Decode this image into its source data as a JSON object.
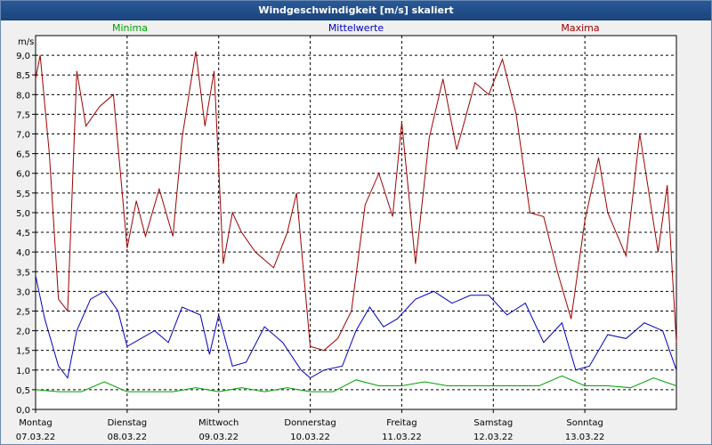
{
  "chart_data": {
    "type": "line",
    "title": "Windgeschwindigkeit [m/s] skaliert",
    "ylabel": "m/s",
    "ylim": [
      0,
      9.5
    ],
    "y_ticks": [
      "0,0",
      "0,5",
      "1,0",
      "1,5",
      "2,0",
      "2,5",
      "3,0",
      "3,5",
      "4,0",
      "4,5",
      "5,0",
      "5,5",
      "6,0",
      "6,5",
      "7,0",
      "7,5",
      "8,0",
      "8,5",
      "9,0"
    ],
    "x_range": [
      0,
      7
    ],
    "x_ticks": [
      {
        "day": "Montag",
        "date": "07.03.22"
      },
      {
        "day": "Dienstag",
        "date": "08.03.22"
      },
      {
        "day": "Mittwoch",
        "date": "09.03.22"
      },
      {
        "day": "Donnerstag",
        "date": "10.03.22"
      },
      {
        "day": "Freitag",
        "date": "11.03.22"
      },
      {
        "day": "Samstag",
        "date": "12.03.22"
      },
      {
        "day": "Sonntag",
        "date": "13.03.22"
      }
    ],
    "grid": true,
    "colors": {
      "min": "#00a000",
      "mean": "#0000c0",
      "max": "#a00000"
    },
    "series": [
      {
        "name": "Minima",
        "x": [
          0,
          0.25,
          0.5,
          0.75,
          1,
          1.25,
          1.5,
          1.75,
          2,
          2.25,
          2.5,
          2.75,
          3,
          3.25,
          3.5,
          3.75,
          4,
          4.25,
          4.5,
          4.75,
          5,
          5.25,
          5.5,
          5.75,
          6,
          6.25,
          6.5,
          6.75,
          7
        ],
        "values": [
          0.5,
          0.45,
          0.45,
          0.7,
          0.45,
          0.45,
          0.45,
          0.55,
          0.45,
          0.55,
          0.45,
          0.55,
          0.45,
          0.45,
          0.75,
          0.6,
          0.6,
          0.7,
          0.6,
          0.6,
          0.6,
          0.6,
          0.6,
          0.85,
          0.6,
          0.6,
          0.55,
          0.8,
          0.6
        ]
      },
      {
        "name": "Mittelwerte",
        "x": [
          0,
          0.1,
          0.25,
          0.35,
          0.45,
          0.6,
          0.75,
          0.9,
          1,
          1.15,
          1.3,
          1.45,
          1.6,
          1.8,
          1.9,
          2,
          2.15,
          2.3,
          2.5,
          2.7,
          2.9,
          3,
          3.15,
          3.35,
          3.5,
          3.65,
          3.8,
          3.95,
          4.15,
          4.35,
          4.55,
          4.75,
          4.95,
          5.15,
          5.35,
          5.55,
          5.75,
          5.9,
          6.05,
          6.25,
          6.45,
          6.65,
          6.85,
          7
        ],
        "values": [
          3.4,
          2.3,
          1.1,
          0.8,
          2.0,
          2.8,
          3.0,
          2.5,
          1.6,
          1.8,
          2.0,
          1.7,
          2.6,
          2.4,
          1.4,
          2.4,
          1.1,
          1.2,
          2.1,
          1.7,
          1.0,
          0.8,
          1.0,
          1.1,
          2.0,
          2.6,
          2.1,
          2.3,
          2.8,
          3.0,
          2.7,
          2.9,
          2.9,
          2.4,
          2.7,
          1.7,
          2.2,
          1.0,
          1.1,
          1.9,
          1.8,
          2.2,
          2.0,
          1.0
        ]
      },
      {
        "name": "Maxima",
        "x": [
          0,
          0.05,
          0.15,
          0.25,
          0.35,
          0.45,
          0.55,
          0.7,
          0.85,
          1,
          1.1,
          1.2,
          1.35,
          1.5,
          1.6,
          1.75,
          1.85,
          1.95,
          2.05,
          2.15,
          2.25,
          2.4,
          2.6,
          2.75,
          2.85,
          3,
          3.15,
          3.3,
          3.45,
          3.6,
          3.75,
          3.9,
          4,
          4.15,
          4.3,
          4.45,
          4.6,
          4.8,
          4.95,
          5.1,
          5.25,
          5.4,
          5.55,
          5.7,
          5.85,
          6,
          6.15,
          6.25,
          6.45,
          6.6,
          6.8,
          6.9,
          7
        ],
        "values": [
          8.4,
          9.0,
          6.5,
          2.8,
          2.5,
          8.6,
          7.2,
          7.7,
          8.0,
          4.1,
          5.3,
          4.4,
          5.6,
          4.4,
          6.9,
          9.1,
          7.2,
          8.6,
          3.7,
          5.0,
          4.5,
          4.0,
          3.6,
          4.5,
          5.5,
          1.6,
          1.5,
          1.8,
          2.5,
          5.2,
          6.0,
          4.9,
          7.3,
          3.7,
          6.9,
          8.4,
          6.6,
          8.3,
          8.0,
          8.9,
          7.5,
          5.0,
          4.9,
          3.5,
          2.3,
          4.8,
          6.4,
          5.0,
          3.9,
          7.0,
          4.0,
          5.7,
          1.7
        ]
      }
    ]
  }
}
